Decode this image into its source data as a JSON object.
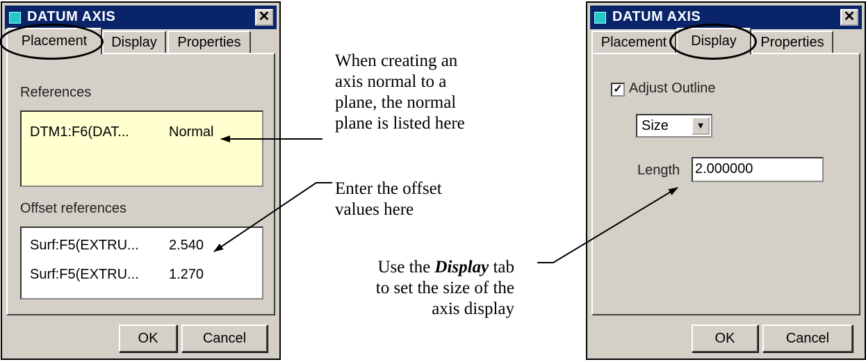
{
  "left_dialog": {
    "title": "DATUM AXIS",
    "close_glyph": "✕",
    "tabs": [
      "Placement",
      "Display",
      "Properties"
    ],
    "references_label": "References",
    "references": [
      {
        "ref": "DTM1:F6(DAT...",
        "type": "Normal"
      }
    ],
    "offset_label": "Offset references",
    "offsets": [
      {
        "ref": "Surf:F5(EXTRU...",
        "value": "2.540"
      },
      {
        "ref": "Surf:F5(EXTRU...",
        "value": "1.270"
      }
    ],
    "ok": "OK",
    "cancel": "Cancel"
  },
  "right_dialog": {
    "title": "DATUM AXIS",
    "close_glyph": "✕",
    "tabs": [
      "Placement",
      "Display",
      "Properties"
    ],
    "adjust_outline_label": "Adjust Outline",
    "adjust_outline_checked": true,
    "check_glyph": "✓",
    "size_select": "Size",
    "length_label": "Length",
    "length_value": "2.000000",
    "ok": "OK",
    "cancel": "Cancel"
  },
  "annotations": {
    "normal_plane": [
      "When creating an",
      "axis normal to a",
      "plane, the normal",
      "plane is listed here"
    ],
    "offset": [
      "Enter the offset",
      "values here"
    ],
    "display_pre": "Use the ",
    "display_em": "Display",
    "display_post": " tab",
    "display_lines": [
      "to set the size of the",
      "axis display"
    ]
  },
  "colors": {
    "title_bar": "#0a246a",
    "dialog_face": "#d4d0c8",
    "reference_box": "#ffffd0"
  }
}
